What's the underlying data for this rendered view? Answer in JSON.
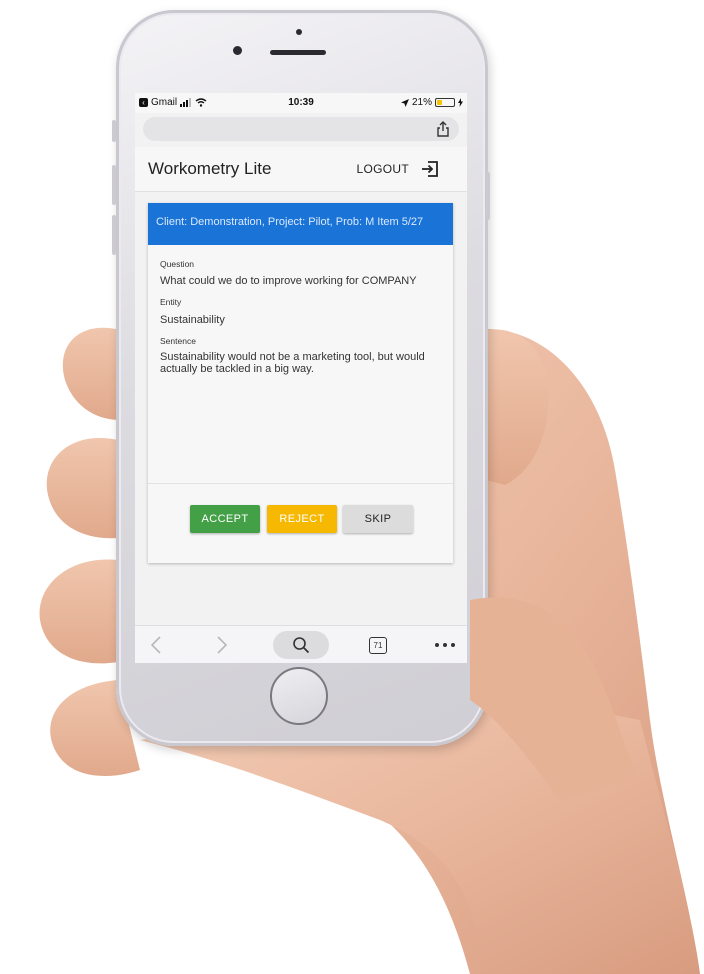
{
  "status_bar": {
    "back_app": "Gmail",
    "time": "10:39",
    "battery": "21%"
  },
  "app": {
    "title": "Workometry Lite",
    "logout_label": "LOGOUT"
  },
  "card": {
    "header": "Client: Demonstration, Project: Pilot, Prob: M Item 5/27",
    "question_label": "Question",
    "question_value": "What could we do to improve working for COMPANY",
    "entity_label": "Entity",
    "entity_value": "Sustainability",
    "sentence_label": "Sentence",
    "sentence_value": "Sustainability would not be a marketing tool, but would actually be tackled in a big way."
  },
  "actions": {
    "accept": "ACCEPT",
    "reject": "REJECT",
    "skip": "SKIP"
  },
  "browser_toolbar": {
    "tab_count": "71"
  },
  "colors": {
    "header_blue": "#1a73d6",
    "accept_green": "#43a047",
    "reject_amber": "#f6b800",
    "skip_grey": "#dcdcdc"
  }
}
